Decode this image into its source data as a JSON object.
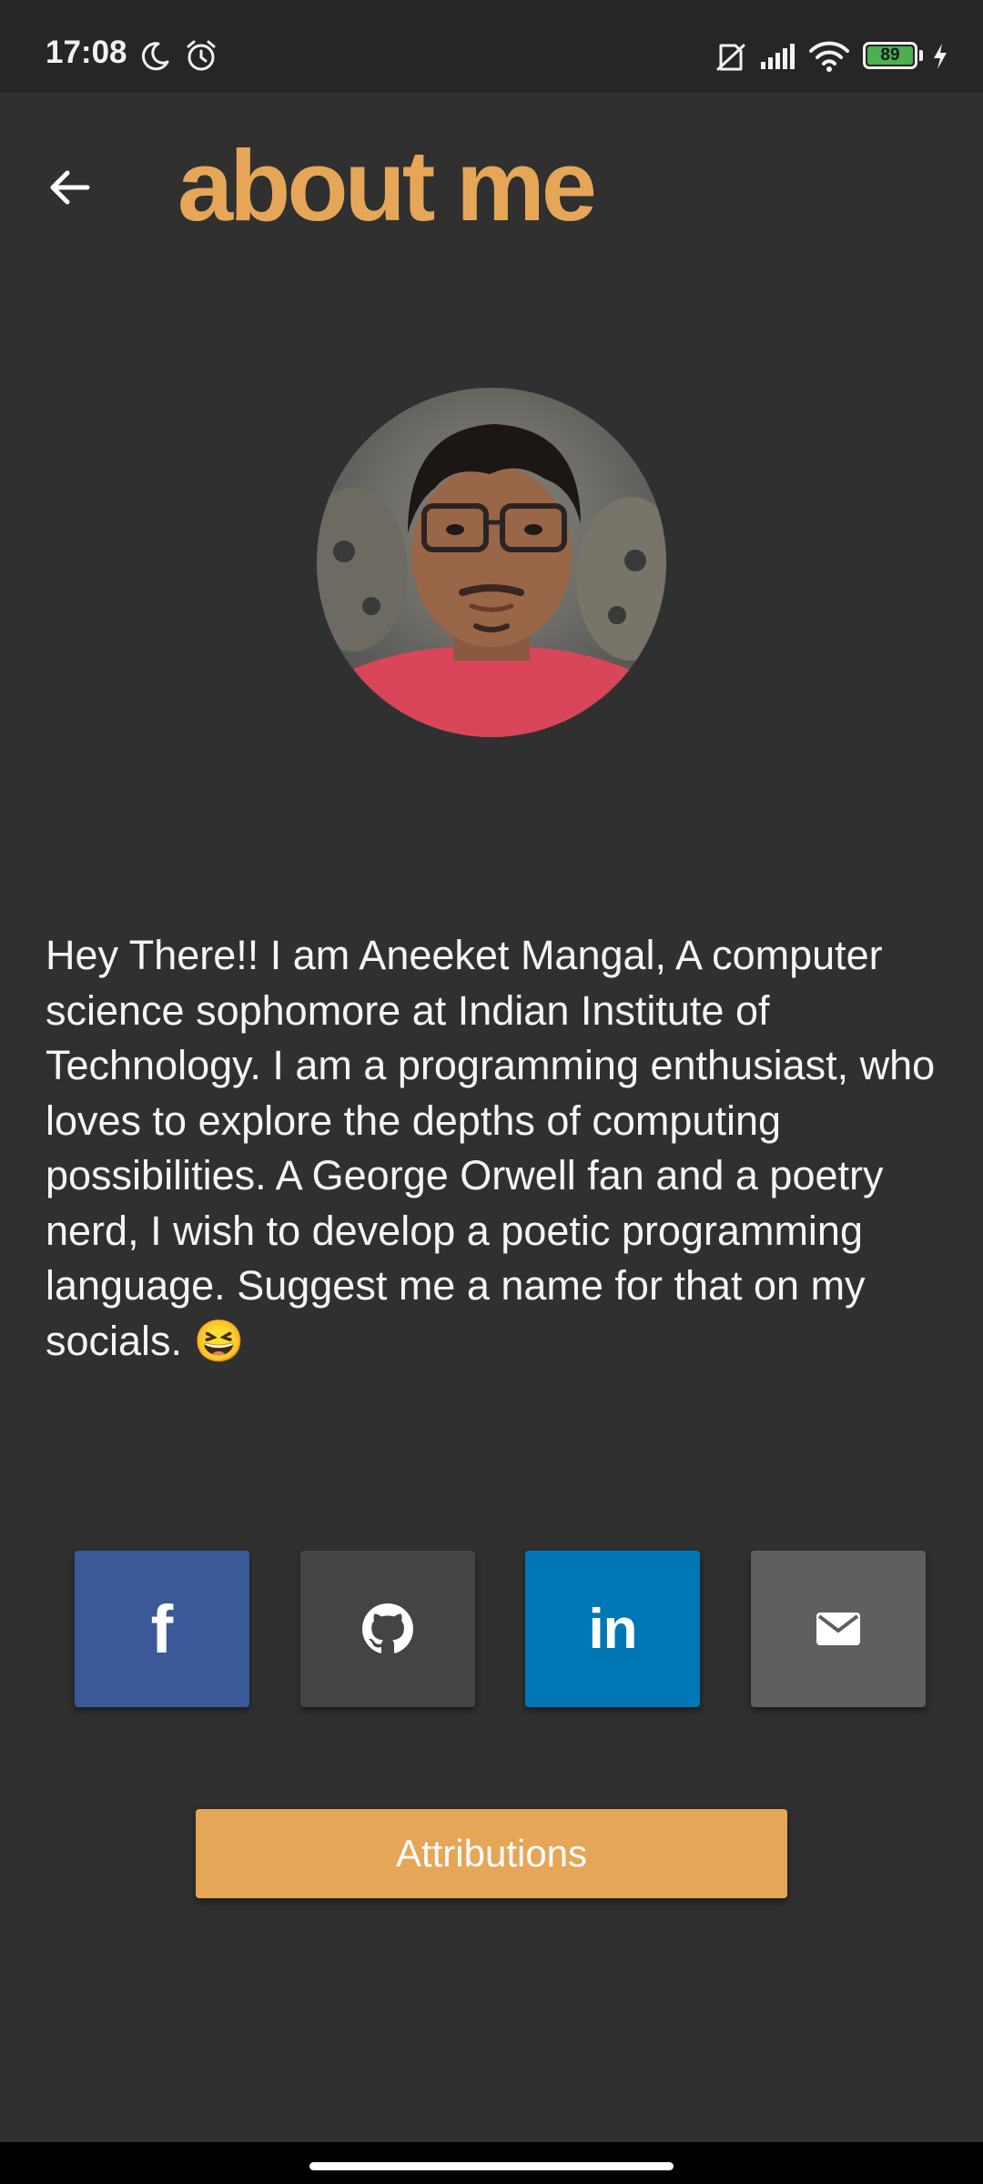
{
  "status_bar": {
    "time": "17:08",
    "battery": "89",
    "icons": [
      "moon-icon",
      "alarm-icon",
      "no-sim-icon",
      "signal-icon",
      "wifi-icon",
      "battery-icon",
      "charging-icon"
    ]
  },
  "header": {
    "back_icon": "arrow-left-icon",
    "title": "about me"
  },
  "profile": {
    "avatar": "profile-photo"
  },
  "bio": {
    "text": "Hey There!! I am Aneeket Mangal, A computer science sophomore at Indian Institute of Technology. I am a programming enthusiast, who loves to explore the depths of computing possibilities. A George Orwell fan and a poetry nerd, I wish to develop a poetic programming language. Suggest me a name for that on my socials. 😆"
  },
  "socials": [
    {
      "name": "facebook",
      "icon": "facebook-icon",
      "color": "#3b5998",
      "glyph": "f"
    },
    {
      "name": "github",
      "icon": "github-icon",
      "color": "#444444"
    },
    {
      "name": "linkedin",
      "icon": "linkedin-icon",
      "color": "#0077b5",
      "glyph": "in"
    },
    {
      "name": "email",
      "icon": "mail-icon",
      "color": "#5f5f5f"
    }
  ],
  "attributions": {
    "label": "Attributions",
    "color": "#e5a658"
  },
  "theme": {
    "background": "#303030",
    "accent": "#e5a658",
    "status_bar": "#262626"
  }
}
